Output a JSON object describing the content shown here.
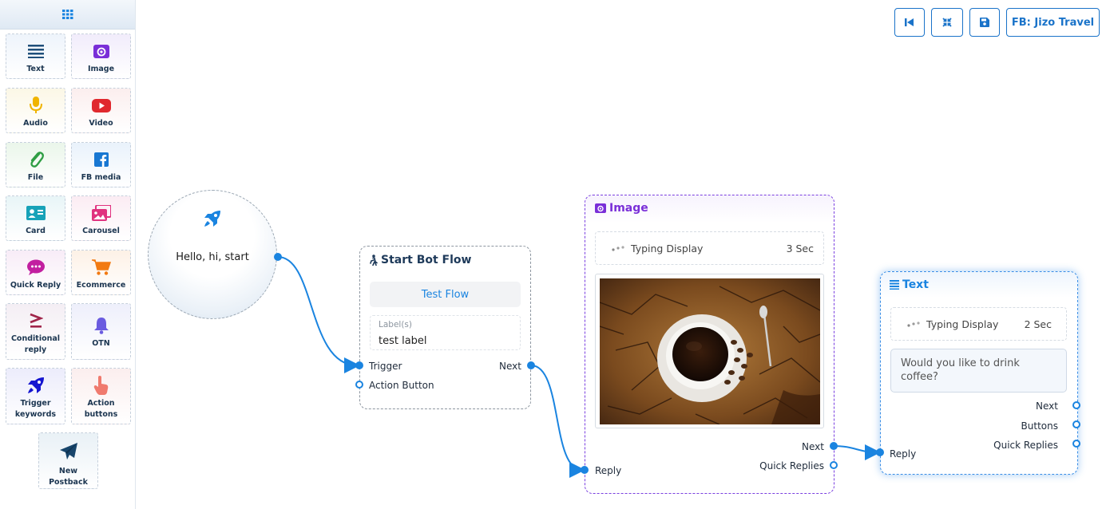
{
  "sidebar": {
    "items": [
      {
        "label": "Text",
        "icon": "text-lines-icon"
      },
      {
        "label": "Image",
        "icon": "image-icon"
      },
      {
        "label": "Audio",
        "icon": "microphone-icon"
      },
      {
        "label": "Video",
        "icon": "youtube-icon"
      },
      {
        "label": "File",
        "icon": "paperclip-icon"
      },
      {
        "label": "FB media",
        "icon": "facebook-icon"
      },
      {
        "label": "Card",
        "icon": "id-card-icon"
      },
      {
        "label": "Carousel",
        "icon": "images-icon"
      },
      {
        "label": "Quick Reply",
        "icon": "chat-bubble-icon"
      },
      {
        "label": "Ecommerce",
        "icon": "cart-icon"
      },
      {
        "label": "Conditional reply",
        "icon": "greater-equal-icon"
      },
      {
        "label": "OTN",
        "icon": "bell-icon"
      },
      {
        "label": "Trigger keywords",
        "icon": "rocket-icon"
      },
      {
        "label": "Action buttons",
        "icon": "pointer-hand-icon"
      },
      {
        "label": "New Postback",
        "icon": "paper-plane-icon"
      }
    ]
  },
  "toolbar": {
    "page_label": "FB: Jizo Travel"
  },
  "start_node": {
    "text": "Hello, hi, start"
  },
  "bot_flow": {
    "title": "Start Bot Flow",
    "flow_name": "Test Flow",
    "labels_placeholder": "Label(s)",
    "labels_value": "test label",
    "trigger": "Trigger",
    "action_button": "Action Button",
    "next": "Next"
  },
  "image_node": {
    "title": "Image",
    "typing_label": "Typing Display",
    "typing_time": "3 Sec",
    "next": "Next",
    "quick_replies": "Quick Replies",
    "reply": "Reply"
  },
  "text_node": {
    "title": "Text",
    "typing_label": "Typing Display",
    "typing_time": "2 Sec",
    "message": "Would you like to drink coffee?",
    "next": "Next",
    "buttons": "Buttons",
    "quick_replies": "Quick Replies",
    "reply": "Reply"
  },
  "colors": {
    "accent": "#1a84e0",
    "image_node_border": "#7a3fe0",
    "text_node_border": "#3a8ee6"
  }
}
